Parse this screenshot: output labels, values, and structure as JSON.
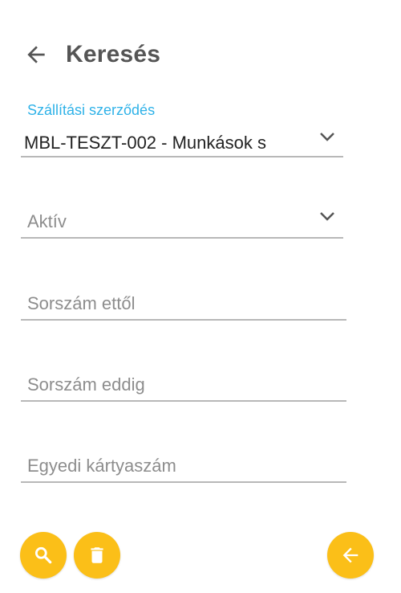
{
  "header": {
    "title": "Keresés",
    "back_icon": "arrow-left-icon"
  },
  "form": {
    "contract": {
      "label": "Szállítási szerződés",
      "value": "MBL-TESZT-002 - Munkások s",
      "icon": "chevron-down-icon"
    },
    "status": {
      "placeholder": "Aktív",
      "icon": "chevron-down-icon"
    },
    "serial_from": {
      "placeholder": "Sorszám ettől"
    },
    "serial_to": {
      "placeholder": "Sorszám eddig"
    },
    "card_number": {
      "placeholder": "Egyedi kártyaszám"
    }
  },
  "actions": {
    "search_icon": "search-icon",
    "delete_icon": "trash-icon",
    "back_icon": "arrow-left-icon",
    "accent_color": "#fbbf18"
  },
  "colors": {
    "label_blue": "#2fb2e8",
    "title_gray": "#555555"
  }
}
